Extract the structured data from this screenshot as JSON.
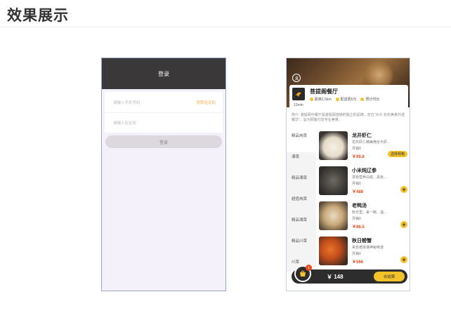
{
  "page_title": "效果展示",
  "login": {
    "header_title": "登录",
    "phone_placeholder": "请输入手机号码",
    "get_code_label": "获取验证码",
    "code_placeholder": "请输入验证码",
    "submit_label": "登录"
  },
  "shop": {
    "name": "菩提阁餐厅",
    "distance": "距离1.5km",
    "delivery_fee": "配送费6元",
    "estimated_time_label": "预计时长",
    "estimated_time_value": "12min",
    "intro": "简介: 菩提阁中餐厅是菩提阁连锁的独立的品牌，定位\"大众 化的美食外送餐饮\"，旨为顾客打造专业美食。"
  },
  "categories": [
    "精品炖菜",
    "湘菜",
    "精品湘菜",
    "超值炖菜",
    "精品湘菜",
    "精品川菜",
    "川菜"
  ],
  "dishes": [
    {
      "name": "龙井虾仁",
      "desc": "龙井虾仁精美绝伦与虾...",
      "sales": "月销0",
      "price": "￥99.8",
      "action": "选择规格"
    },
    {
      "name": "小米炖辽参",
      "desc": "享受营养白底，具有...",
      "sales": "月销0",
      "price": "￥488",
      "action": "+"
    },
    {
      "name": "老鸭汤",
      "desc": "秋日里，来一碗、温...",
      "sales": "月销0",
      "price": "￥86.5",
      "action": "+"
    },
    {
      "name": "秋日螃蟹",
      "desc": "来自老房港神秘味道",
      "sales": "月销0",
      "price": "￥566",
      "action": "+"
    }
  ],
  "cart": {
    "badge": "1",
    "total": "￥ 148",
    "checkout_label": "去结算"
  },
  "colors": {
    "accent": "#f4c22b",
    "price": "#e74c1f",
    "header_dark": "#3b3839"
  }
}
